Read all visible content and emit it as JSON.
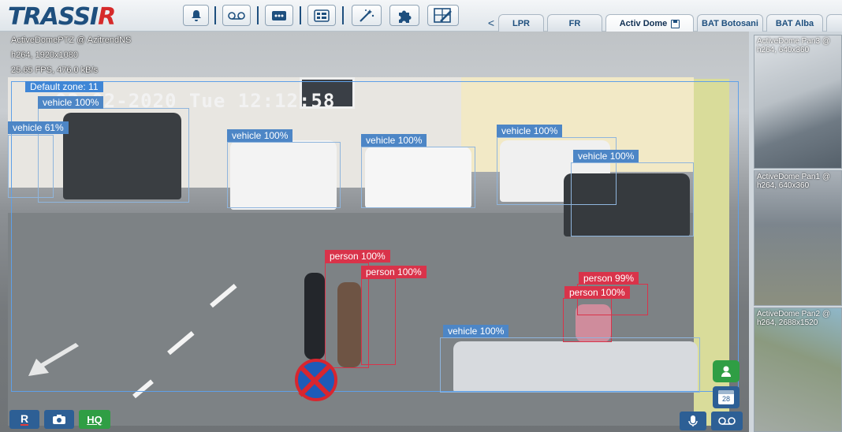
{
  "app": {
    "logo_main": "TRASSI",
    "logo_accent": "R"
  },
  "toolbar": {
    "buttons": [
      "bell-icon",
      "tape-icon",
      "chat-icon",
      "layout-icon",
      "magic-wand-icon",
      "puzzle-icon",
      "edit-layout-icon"
    ]
  },
  "tabs": {
    "arrow": "<",
    "items": [
      {
        "label": "LPR"
      },
      {
        "label": "FR"
      },
      {
        "label": "Activ Dome",
        "active": true
      },
      {
        "label": "BAT Botosani"
      },
      {
        "label": "BAT Alba"
      }
    ]
  },
  "main": {
    "camera_title": "ActiveDomePTZ @ AzitrendNS",
    "codec": "h264, 1920x1080",
    "stats": "25.65 FPS, 476.0 kB/s",
    "zone": "Default zone: 11",
    "timestamp": "03-02-2020 Tue 12:12:58",
    "detections": [
      {
        "label": "vehicle 100%",
        "type": "vehicle"
      },
      {
        "label": "vehicle 61%",
        "type": "vehicle"
      },
      {
        "label": "vehicle 100%",
        "type": "vehicle"
      },
      {
        "label": "vehicle 100%",
        "type": "vehicle"
      },
      {
        "label": "vehicle 100%",
        "type": "vehicle"
      },
      {
        "label": "vehicle 100%",
        "type": "vehicle"
      },
      {
        "label": "person 100%",
        "type": "person"
      },
      {
        "label": "person 100%",
        "type": "person"
      },
      {
        "label": "person 99%",
        "type": "person"
      },
      {
        "label": "person 100%",
        "type": "person"
      },
      {
        "label": "vehicle 100%",
        "type": "vehicle"
      }
    ],
    "bottom_left": {
      "record_label": "R",
      "snapshot": "camera-icon",
      "hq_label": "HQ"
    },
    "bottom_right": {
      "download": "download-icon",
      "calendar_day": "28",
      "mic": "microphone-icon",
      "archive": "tape-icon"
    }
  },
  "thumbnails": [
    {
      "title": "ActiveDome Pan3 @",
      "info": "h264, 640x360"
    },
    {
      "title": "ActiveDome Pan1 @",
      "info": "h264, 640x360"
    },
    {
      "title": "ActiveDome Pan2 @",
      "info": "h264, 2688x1520"
    }
  ],
  "colors": {
    "brand_blue": "#1e4f7e",
    "brand_red": "#d62a2a",
    "vehicle_box": "#4d86c6",
    "person_box": "#d9334a",
    "zone": "#3f86d6",
    "action_green": "#2f9e44"
  }
}
